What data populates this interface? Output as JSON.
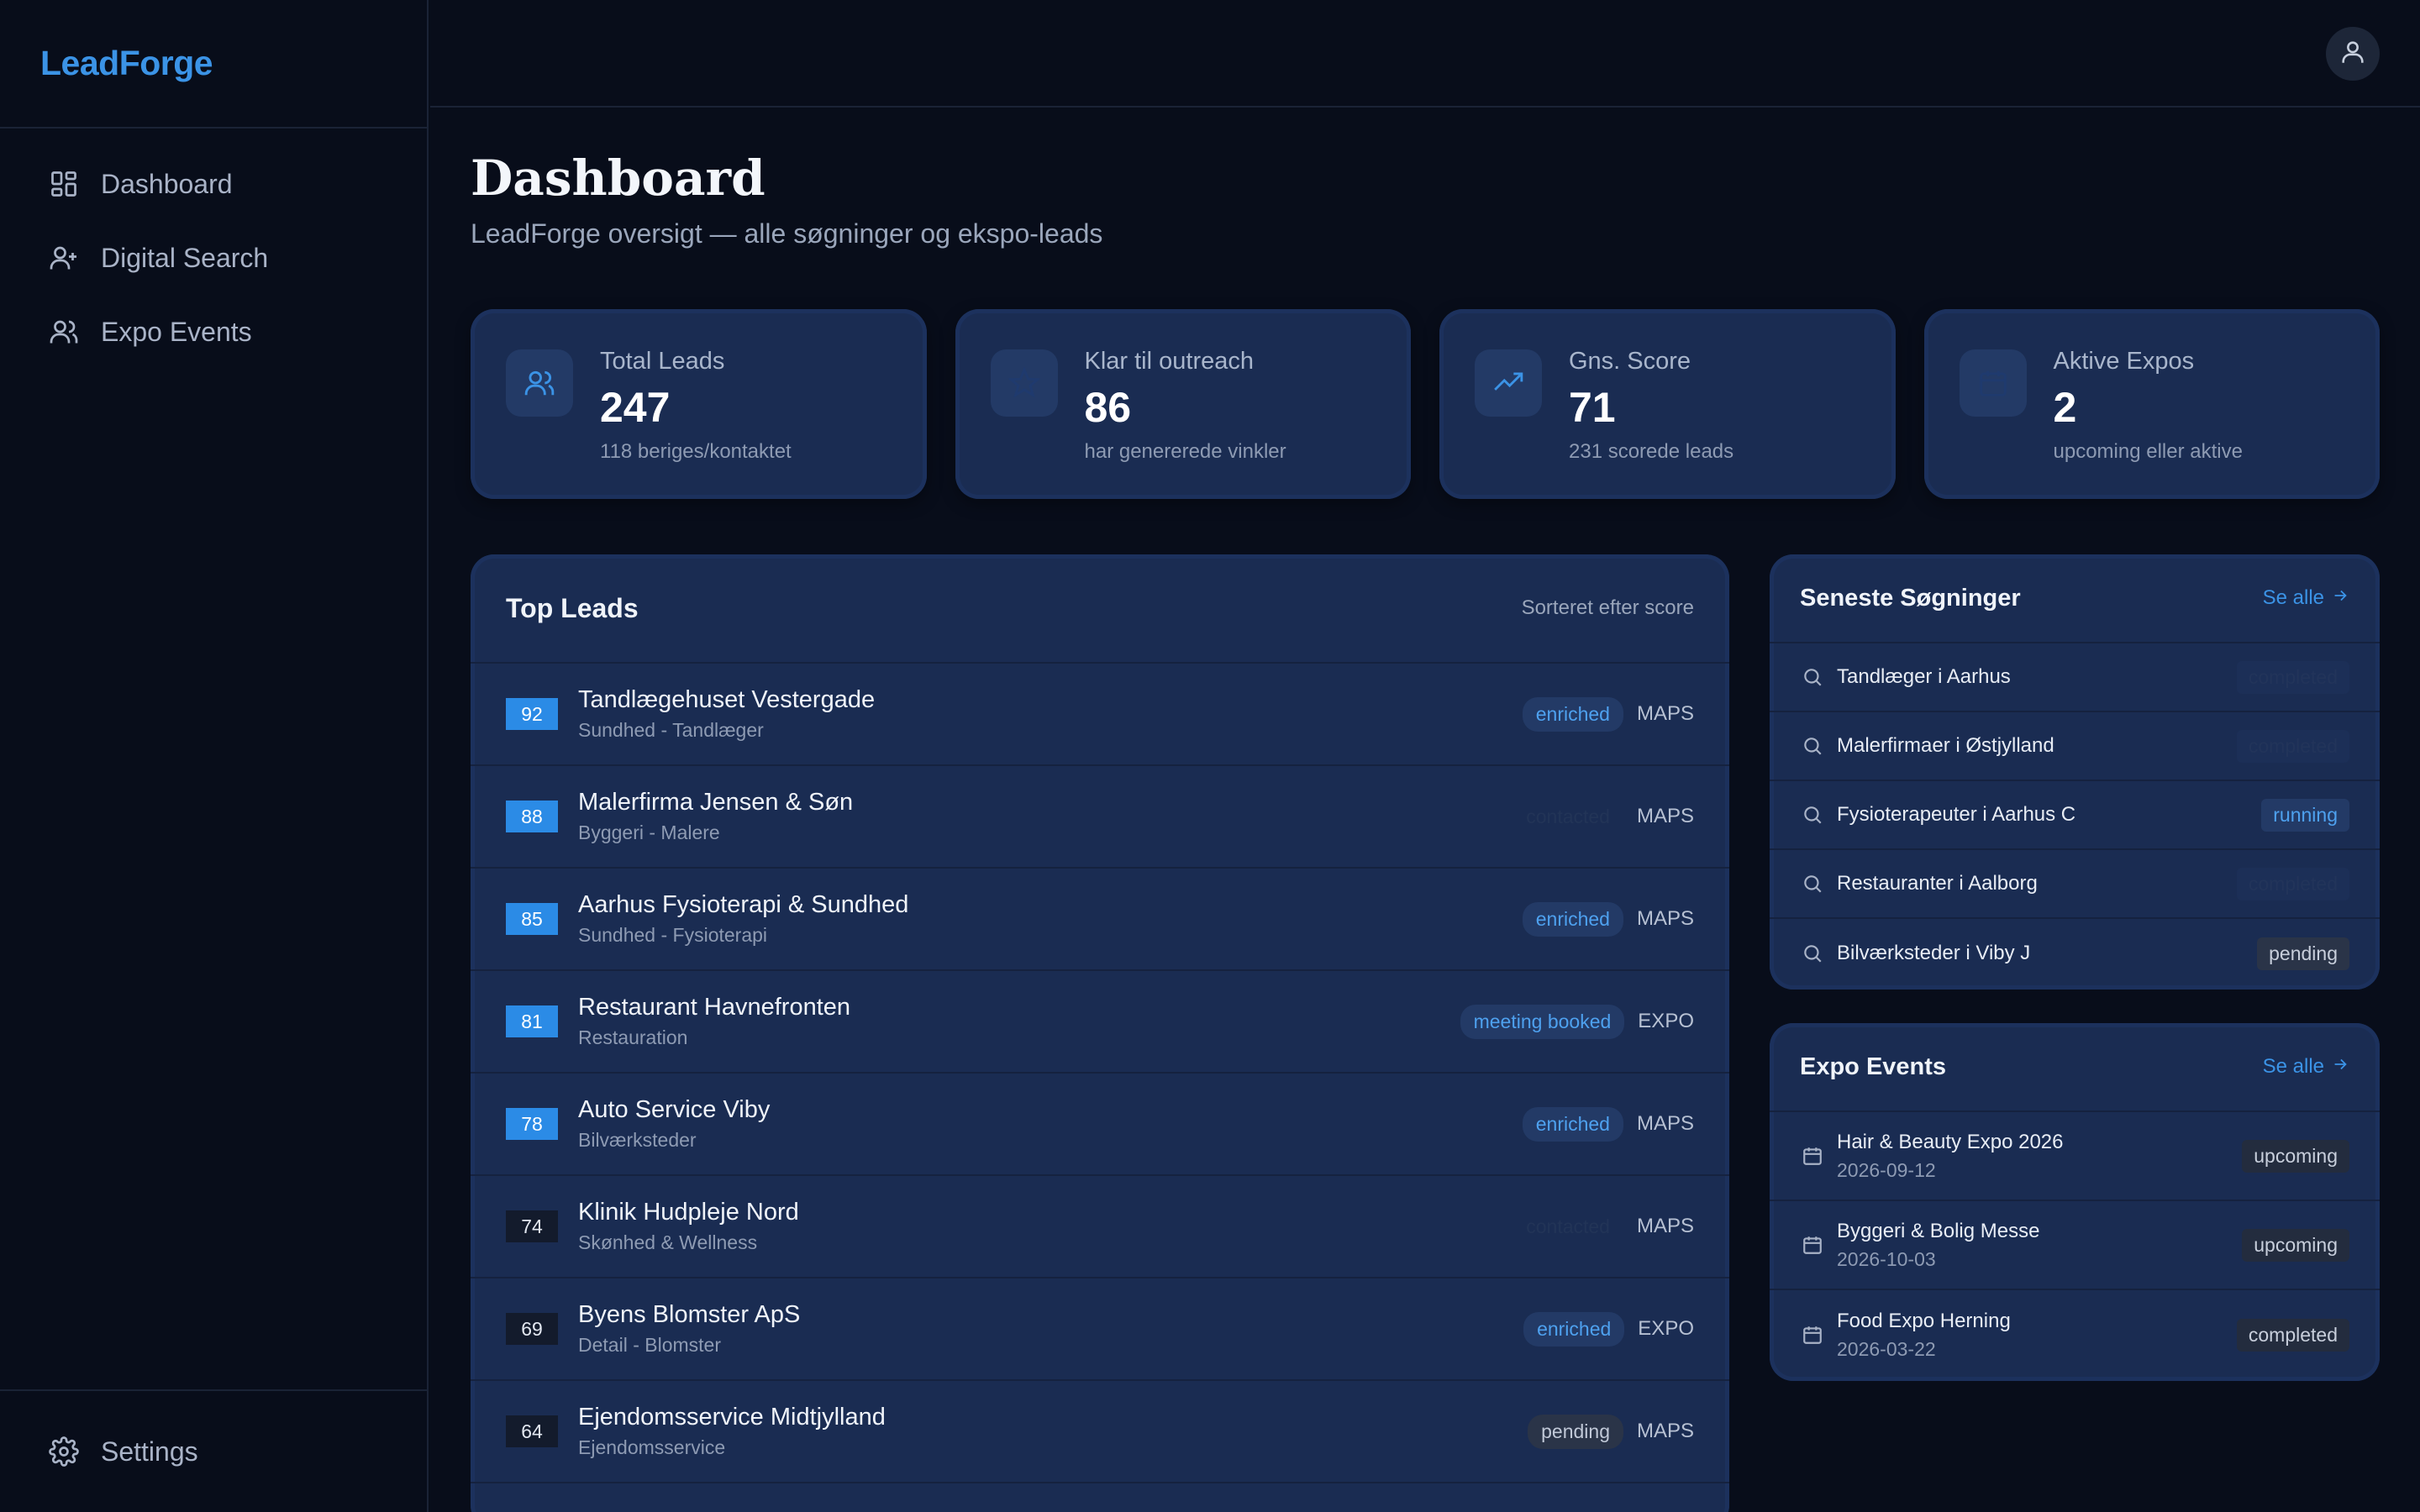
{
  "app": {
    "brand": "LeadForge"
  },
  "sidebar": {
    "items": [
      {
        "label": "Dashboard",
        "icon": "dashboard-grid-icon"
      },
      {
        "label": "Digital Search",
        "icon": "user-plus-icon"
      },
      {
        "label": "Expo Events",
        "icon": "users-icon"
      }
    ],
    "settings": {
      "label": "Settings",
      "icon": "gear-icon"
    }
  },
  "topbar": {
    "avatar_icon": "user-icon"
  },
  "header": {
    "title": "Dashboard",
    "subtitle": "LeadForge oversigt — alle søgninger og ekspo-leads"
  },
  "stats": [
    {
      "label": "Total Leads",
      "value": "247",
      "sub": "118 beriges/kontaktet",
      "icon": "users-icon"
    },
    {
      "label": "Klar til outreach",
      "value": "86",
      "sub": "har genererede vinkler",
      "icon": "star-icon"
    },
    {
      "label": "Gns. Score",
      "value": "71",
      "sub": "231 scorede leads",
      "icon": "trending-up-icon"
    },
    {
      "label": "Aktive Expos",
      "value": "2",
      "sub": "upcoming eller aktive",
      "icon": "calendar-icon"
    }
  ],
  "top_leads": {
    "title": "Top Leads",
    "sort_note": "Sorteret efter score",
    "rows": [
      {
        "score": "92",
        "name": "Tandlægehuset Vestergade",
        "category": "Sundhed - Tandlæger",
        "status": "enriched",
        "source": "MAPS"
      },
      {
        "score": "88",
        "name": "Malerfirma Jensen & Søn",
        "category": "Byggeri - Malere",
        "status": "contacted",
        "source": "MAPS"
      },
      {
        "score": "85",
        "name": "Aarhus Fysioterapi & Sundhed",
        "category": "Sundhed - Fysioterapi",
        "status": "enriched",
        "source": "MAPS"
      },
      {
        "score": "81",
        "name": "Restaurant Havnefronten",
        "category": "Restauration",
        "status": "meeting booked",
        "source": "EXPO"
      },
      {
        "score": "78",
        "name": "Auto Service Viby",
        "category": "Bilværksteder",
        "status": "enriched",
        "source": "MAPS"
      },
      {
        "score": "74",
        "name": "Klinik Hudpleje Nord",
        "category": "Skønhed & Wellness",
        "status": "contacted",
        "source": "MAPS"
      },
      {
        "score": "69",
        "name": "Byens Blomster ApS",
        "category": "Detail - Blomster",
        "status": "enriched",
        "source": "EXPO"
      },
      {
        "score": "64",
        "name": "Ejendomsservice Midtjylland",
        "category": "Ejendomsservice",
        "status": "pending",
        "source": "MAPS"
      }
    ]
  },
  "recent_searches": {
    "title": "Seneste Søgninger",
    "see_all": "Se alle",
    "rows": [
      {
        "query": "Tandlæger i Aarhus",
        "status": "completed"
      },
      {
        "query": "Malerfirmaer i Østjylland",
        "status": "completed"
      },
      {
        "query": "Fysioterapeuter i Aarhus C",
        "status": "running"
      },
      {
        "query": "Restauranter i Aalborg",
        "status": "completed"
      },
      {
        "query": "Bilværksteder i Viby J",
        "status": "pending"
      }
    ]
  },
  "expo_events": {
    "title": "Expo Events",
    "see_all": "Se alle",
    "rows": [
      {
        "name": "Hair & Beauty Expo 2026",
        "date": "2026-09-12",
        "status": "upcoming"
      },
      {
        "name": "Byggeri & Bolig Messe",
        "date": "2026-10-03",
        "status": "upcoming"
      },
      {
        "name": "Food Expo Herning",
        "date": "2026-03-22",
        "status": "completed"
      }
    ]
  },
  "colors": {
    "accent": "#3b93e6",
    "background": "#080d1a",
    "card": "#1a2c52"
  }
}
